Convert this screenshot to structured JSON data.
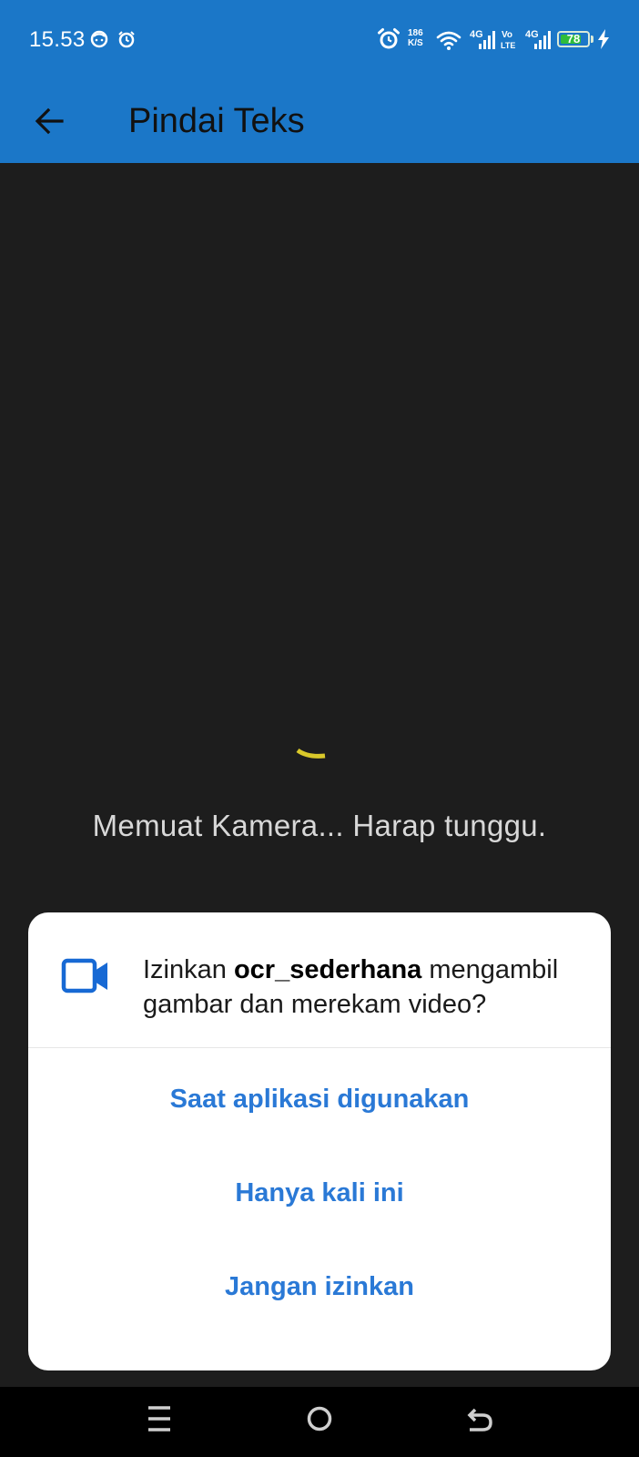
{
  "status_bar": {
    "time": "15.53",
    "net_speed_value": "186",
    "net_speed_unit": "K/S",
    "battery_level": "78",
    "battery_fraction": 0.78,
    "battery_color": "#2fbd3a"
  },
  "app_bar": {
    "title": "Pindai Teks",
    "color": "#1b77c8"
  },
  "camera": {
    "loading_text": "Memuat Kamera... Harap tunggu.",
    "spinner_color": "#d9c82a"
  },
  "permission_dialog": {
    "message_prefix": "Izinkan ",
    "app_name": "ocr_sederhana",
    "message_suffix": " mengambil gambar dan merekam video?",
    "icon": "videocam-icon",
    "options": [
      "Saat aplikasi digunakan",
      "Hanya kali ini",
      "Jangan izinkan"
    ],
    "accent_color": "#2a79d6"
  },
  "nav_bar": {
    "buttons": [
      "menu-icon",
      "home-icon",
      "back-icon"
    ]
  }
}
